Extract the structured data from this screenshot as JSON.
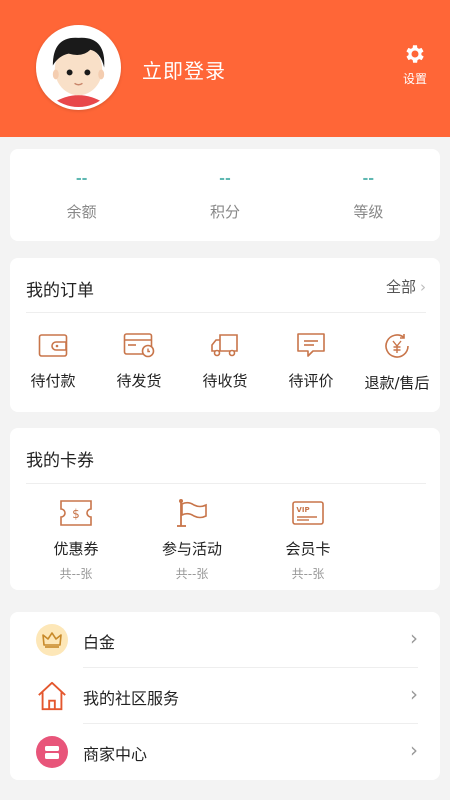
{
  "header": {
    "login_text": "立即登录",
    "settings_label": "设置"
  },
  "stats": [
    {
      "value": "--",
      "label": "余额"
    },
    {
      "value": "--",
      "label": "积分"
    },
    {
      "value": "--",
      "label": "等级"
    }
  ],
  "orders": {
    "title": "我的订单",
    "all_label": "全部",
    "items": [
      {
        "label": "待付款",
        "icon": "wallet-icon"
      },
      {
        "label": "待发货",
        "icon": "card-clock-icon"
      },
      {
        "label": "待收货",
        "icon": "truck-icon"
      },
      {
        "label": "待评价",
        "icon": "comment-icon"
      },
      {
        "label": "退款/售后",
        "icon": "refund-icon"
      }
    ]
  },
  "vouchers": {
    "title": "我的卡券",
    "items": [
      {
        "label": "优惠券",
        "count": "共--张",
        "icon": "coupon-icon"
      },
      {
        "label": "参与活动",
        "count": "共--张",
        "icon": "flag-icon"
      },
      {
        "label": "会员卡",
        "count": "共--张",
        "icon": "vip-card-icon"
      }
    ]
  },
  "menu": [
    {
      "label": "白金",
      "icon": "crown-icon"
    },
    {
      "label": "我的社区服务",
      "icon": "house-icon"
    },
    {
      "label": "商家中心",
      "icon": "store-icon"
    }
  ],
  "colors": {
    "brand": "#ff6637",
    "accent_icon": "#c8754a",
    "stat_value": "#5fb8b2"
  }
}
